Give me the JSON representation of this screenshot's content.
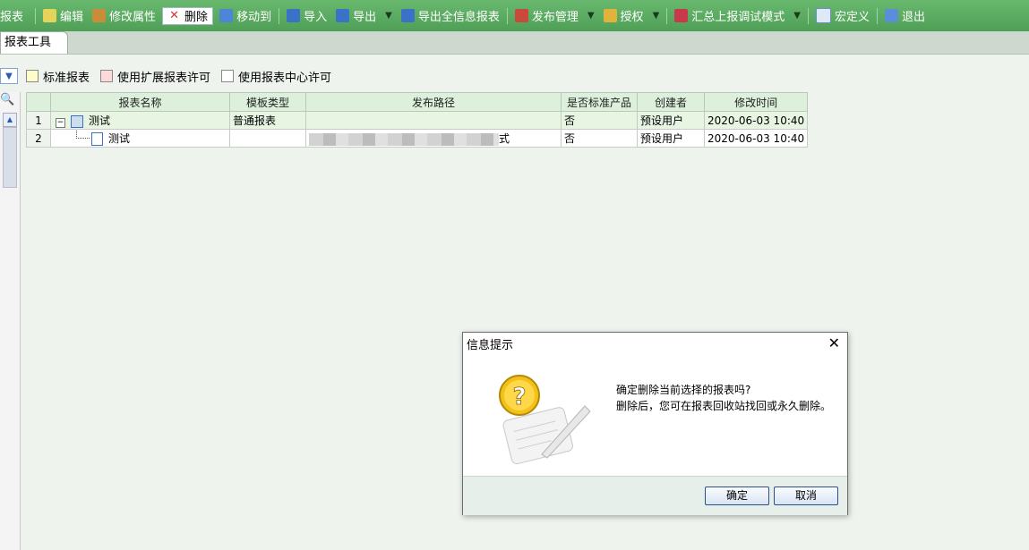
{
  "toolbar": {
    "items": [
      {
        "label": "报表",
        "icon": "report-icon"
      },
      {
        "label": "编辑",
        "icon": "edit-icon"
      },
      {
        "label": "修改属性",
        "icon": "properties-icon"
      },
      {
        "label": "删除",
        "icon": "delete-icon"
      },
      {
        "label": "移动到",
        "icon": "move-icon"
      },
      {
        "label": "导入",
        "icon": "import-icon"
      },
      {
        "label": "导出",
        "icon": "export-icon"
      },
      {
        "label": "导出全信息报表",
        "icon": "export-full-icon"
      },
      {
        "label": "发布管理",
        "icon": "publish-icon"
      },
      {
        "label": "授权",
        "icon": "authorize-icon"
      },
      {
        "label": "汇总上报调试模式",
        "icon": "summary-icon"
      },
      {
        "label": "宏定义",
        "icon": "macro-icon"
      },
      {
        "label": "退出",
        "icon": "exit-icon"
      }
    ]
  },
  "tabs": {
    "active": "报表工具"
  },
  "legend": {
    "items": [
      {
        "label": "标准报表",
        "color": "#fffccc"
      },
      {
        "label": "使用扩展报表许可",
        "color": "#ffd9d9"
      },
      {
        "label": "使用报表中心许可",
        "color": "#ffffff"
      }
    ]
  },
  "table": {
    "columns": [
      "报表名称",
      "模板类型",
      "发布路径",
      "是否标准产品",
      "创建者",
      "修改时间"
    ],
    "rows": [
      {
        "num": "1",
        "name": "测试",
        "type": "普通报表",
        "path": "",
        "standard": "否",
        "creator": "预设用户",
        "modified": "2020-06-03 10:40"
      },
      {
        "num": "2",
        "name": "测试",
        "type": "",
        "path_suffix": "式",
        "standard": "否",
        "creator": "预设用户",
        "modified": "2020-06-03 10:40"
      }
    ]
  },
  "dialog": {
    "title": "信息提示",
    "line1": "确定删除当前选择的报表吗?",
    "line2": "删除后，您可在报表回收站找回或永久删除。",
    "ok": "确定",
    "cancel": "取消",
    "icon": "question-icon"
  }
}
